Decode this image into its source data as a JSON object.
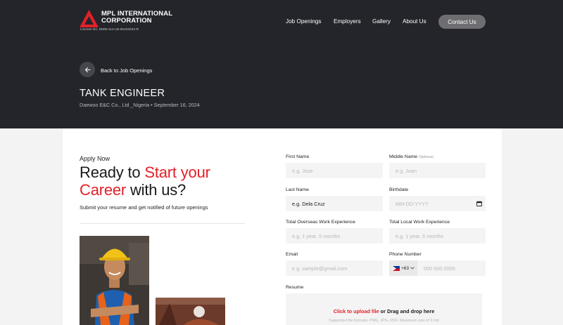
{
  "brand": {
    "name_line1": "MPL INTERNATIONAL",
    "name_line2": "CORPORATION",
    "license": "License No. DMW-112-LB-06152023-R",
    "logo_text": "MPL"
  },
  "nav": {
    "items": [
      "Job Openings",
      "Employers",
      "Gallery",
      "About Us"
    ],
    "contact_label": "Contact Us"
  },
  "hero": {
    "back_label": "Back to Job Openings",
    "job_title": "TANK ENGINEER",
    "job_meta": "Daewoo E&C Co., Ltd _Nigeria • September 16, 2024"
  },
  "intro": {
    "apply_now": "Apply Now",
    "headline_part1": "Ready to ",
    "headline_part2": "Start your",
    "headline_part3": "Career",
    "headline_part4": " with us?",
    "subtitle": "Submit your resume and get notified of future openings"
  },
  "form": {
    "first_name": {
      "label": "First Name",
      "placeholder": "e.g. Jose"
    },
    "middle_name": {
      "label": "Middle Name",
      "optional": "Optional",
      "placeholder": "e.g. Juan"
    },
    "last_name": {
      "label": "Last Name",
      "value": "e.g. Dela Cruz"
    },
    "birthdate": {
      "label": "Birthdate",
      "placeholder": "MM-DD-YYYY"
    },
    "overseas_exp": {
      "label": "Total Overseas Work Experience",
      "placeholder": "e.g. 1 year, 6 months"
    },
    "local_exp": {
      "label": "Total Local Work Experience",
      "placeholder": "e.g. 1 year, 6 months"
    },
    "email": {
      "label": "Email",
      "placeholder": "e.g. sample@gmail.com"
    },
    "phone": {
      "label": "Phone Number",
      "country_code": "+63",
      "placeholder": "000 000 0000"
    },
    "resume": {
      "label": "Resume",
      "upload_link": "Click to upload file",
      "upload_rest": " or Drag and drop here",
      "formats": "Supported file formats: PNG, JPG, PDF. Maximum size of 3 mb"
    }
  },
  "colors": {
    "accent": "#e32028",
    "hero_bg": "#24252b",
    "field_bg": "#f4f4f4"
  }
}
